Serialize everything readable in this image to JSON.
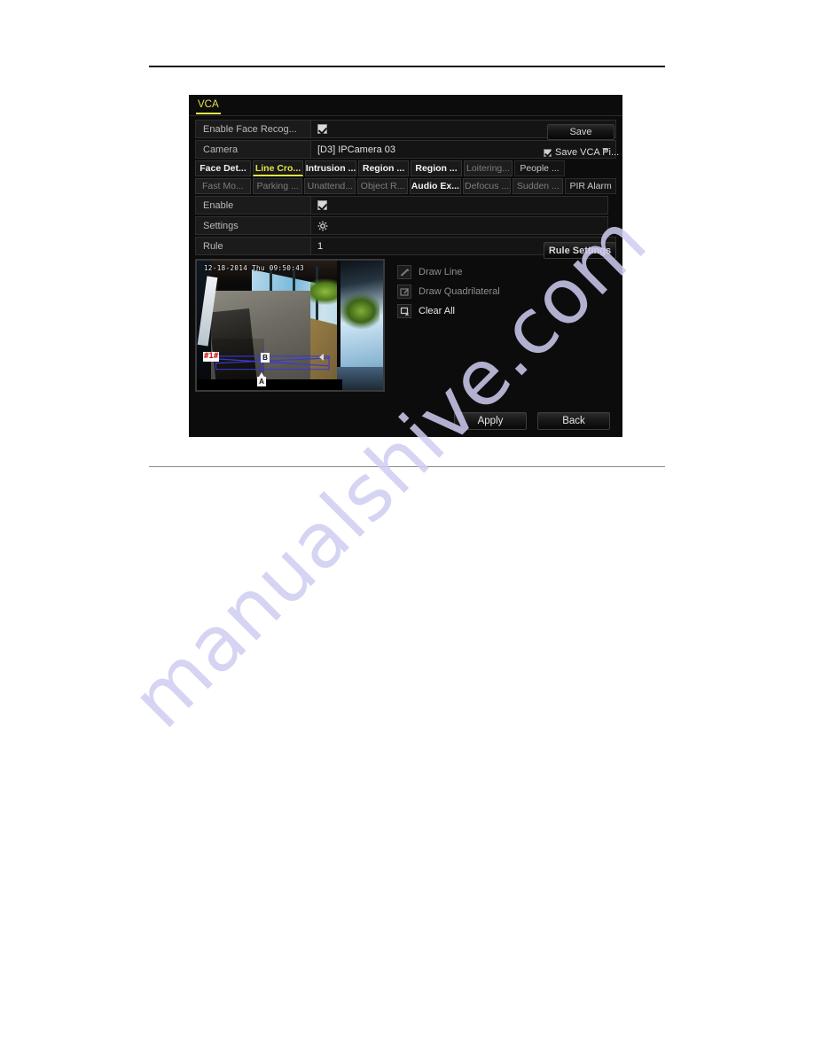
{
  "panel": {
    "tab_label": "VCA"
  },
  "form": {
    "enable_face_recog": {
      "label": "Enable Face Recog...",
      "checked": true
    },
    "camera": {
      "label": "Camera",
      "value": "[D3] IPCamera 03"
    },
    "enable": {
      "label": "Enable",
      "checked": true
    },
    "settings": {
      "label": "Settings",
      "icon": "gear-icon"
    },
    "rule": {
      "label": "Rule",
      "value": "1"
    }
  },
  "buttons": {
    "save": "Save",
    "rule_settings": "Rule Settings",
    "apply": "Apply",
    "back": "Back"
  },
  "save_vca_picture": {
    "label": "Save VCA Pi...",
    "checked": true
  },
  "feature_tabs": {
    "row1": [
      {
        "label": "Face Det...",
        "state": "on"
      },
      {
        "label": "Line Cro...",
        "state": "selected"
      },
      {
        "label": "Intrusion ...",
        "state": "on"
      },
      {
        "label": "Region ...",
        "state": "on"
      },
      {
        "label": "Region ...",
        "state": "on"
      },
      {
        "label": "Loitering...",
        "state": "dim"
      },
      {
        "label": "People ...",
        "state": "plain"
      }
    ],
    "row2": [
      {
        "label": "Fast Mo...",
        "state": "dim"
      },
      {
        "label": "Parking ...",
        "state": "dim"
      },
      {
        "label": "Unattend...",
        "state": "dim"
      },
      {
        "label": "Object R...",
        "state": "dim"
      },
      {
        "label": "Audio Ex...",
        "state": "on"
      },
      {
        "label": "Defocus ...",
        "state": "dim"
      },
      {
        "label": "Sudden ...",
        "state": "dim"
      },
      {
        "label": "PIR Alarm",
        "state": "plain"
      }
    ]
  },
  "draw_tools": [
    {
      "label": "Draw Line",
      "icon": "draw-line-icon",
      "active": false
    },
    {
      "label": "Draw Quadrilateral",
      "icon": "draw-quadrilateral-icon",
      "active": false
    },
    {
      "label": "Clear All",
      "icon": "clear-all-icon",
      "active": true
    }
  ],
  "preview": {
    "timestamp": "12-18-2014 Thu 09:50:43",
    "rule_badge": "#1#",
    "marker_a": "A",
    "marker_b": "B"
  },
  "watermark": {
    "text": "manualshive.com"
  },
  "colors": {
    "accent_yellow": "#e3e34a",
    "panel_bg": "#0c0c0c",
    "badge_red": "#cc1111",
    "line_blue": "#3a3ad0",
    "watermark": "#cfcdf2"
  }
}
